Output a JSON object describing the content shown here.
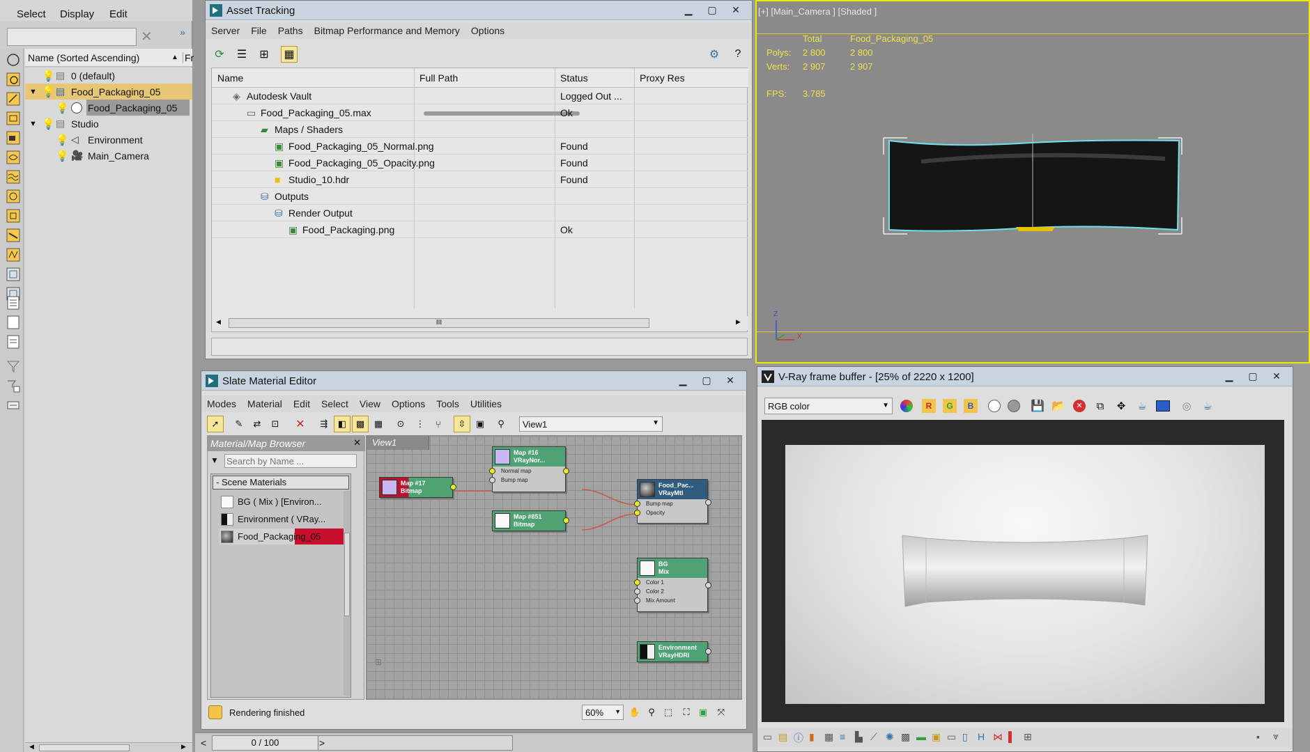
{
  "scene_explorer": {
    "menu": [
      "Select",
      "Display",
      "Edit"
    ],
    "column_header": "Name (Sorted Ascending)",
    "column_header_2": "Fr",
    "items": [
      {
        "label": "0 (default)",
        "level": 0
      },
      {
        "label": "Food_Packaging_05",
        "level": 0
      },
      {
        "label": "Food_Packaging_05",
        "level": 1
      },
      {
        "label": "Studio",
        "level": 0
      },
      {
        "label": "Environment",
        "level": 1
      },
      {
        "label": "Main_Camera",
        "level": 1
      }
    ]
  },
  "asset_tracking": {
    "title": "Asset Tracking",
    "menu": [
      "Server",
      "File",
      "Paths",
      "Bitmap Performance and Memory",
      "Options"
    ],
    "columns": [
      "Name",
      "Full Path",
      "Status",
      "Proxy Res"
    ],
    "rows": [
      {
        "name": "Autodesk Vault",
        "status": "Logged Out ..."
      },
      {
        "name": "Food_Packaging_05.max",
        "status": "Ok"
      },
      {
        "name": "Maps / Shaders",
        "status": ""
      },
      {
        "name": "Food_Packaging_05_Normal.png",
        "status": "Found"
      },
      {
        "name": "Food_Packaging_05_Opacity.png",
        "status": "Found"
      },
      {
        "name": "Studio_10.hdr",
        "status": "Found"
      },
      {
        "name": "Outputs",
        "status": ""
      },
      {
        "name": "Render Output",
        "status": ""
      },
      {
        "name": "Food_Packaging.png",
        "status": "Ok"
      }
    ],
    "scroll_grip": "III"
  },
  "viewport": {
    "label": "[+] [Main_Camera ] [Shaded ]",
    "stats_header_total": "Total",
    "stats_header_object": "Food_Packaging_05",
    "polys_label": "Polys:",
    "polys_total": "2 800",
    "polys_object": "2 800",
    "verts_label": "Verts:",
    "verts_total": "2 907",
    "verts_object": "2 907",
    "fps_label": "FPS:",
    "fps_value": "3.785",
    "axis_z": "Z",
    "axis_x": "X",
    "border_color": "#f0e600"
  },
  "slate": {
    "title": "Slate Material Editor",
    "menu": [
      "Modes",
      "Material",
      "Edit",
      "Select",
      "View",
      "Options",
      "Tools",
      "Utilities"
    ],
    "view_dropdown": "View1",
    "browser_title": "Material/Map Browser",
    "search_placeholder": "Search by Name ...",
    "scene_materials_label": "- Scene Materials",
    "materials": [
      "BG  ( Mix )  [Environ...",
      "Environment  ( VRay...",
      "Food_Packaging_05"
    ],
    "view_tab": "View1",
    "nodes": {
      "map17": {
        "line1": "Map #17",
        "line2": "Bitmap"
      },
      "map16": {
        "line1": "Map #16",
        "line2": "VRayNor...",
        "slots": [
          "Normal map",
          "Bump map"
        ]
      },
      "map851": {
        "line1": "Map #851",
        "line2": "Bitmap"
      },
      "food": {
        "line1": "Food_Pac...",
        "line2": "VRayMtl",
        "slots": [
          "Bump map",
          "Opacity"
        ]
      },
      "bg": {
        "line1": "BG",
        "line2": "Mix",
        "slots": [
          "Color 1",
          "Color 2",
          "Mix Amount"
        ]
      },
      "env": {
        "line1": "Environment",
        "line2": "VRayHDRI"
      }
    },
    "status": "Rendering finished",
    "zoom": "60%"
  },
  "timeline": {
    "frame": "0 / 100"
  },
  "vfb": {
    "title": "V-Ray frame buffer - [25% of 2220 x 1200]",
    "channel": "RGB color"
  },
  "colors": {
    "accent": "#4fa273",
    "node_selected": "#2f5b7c",
    "wire": "#cc5544"
  }
}
